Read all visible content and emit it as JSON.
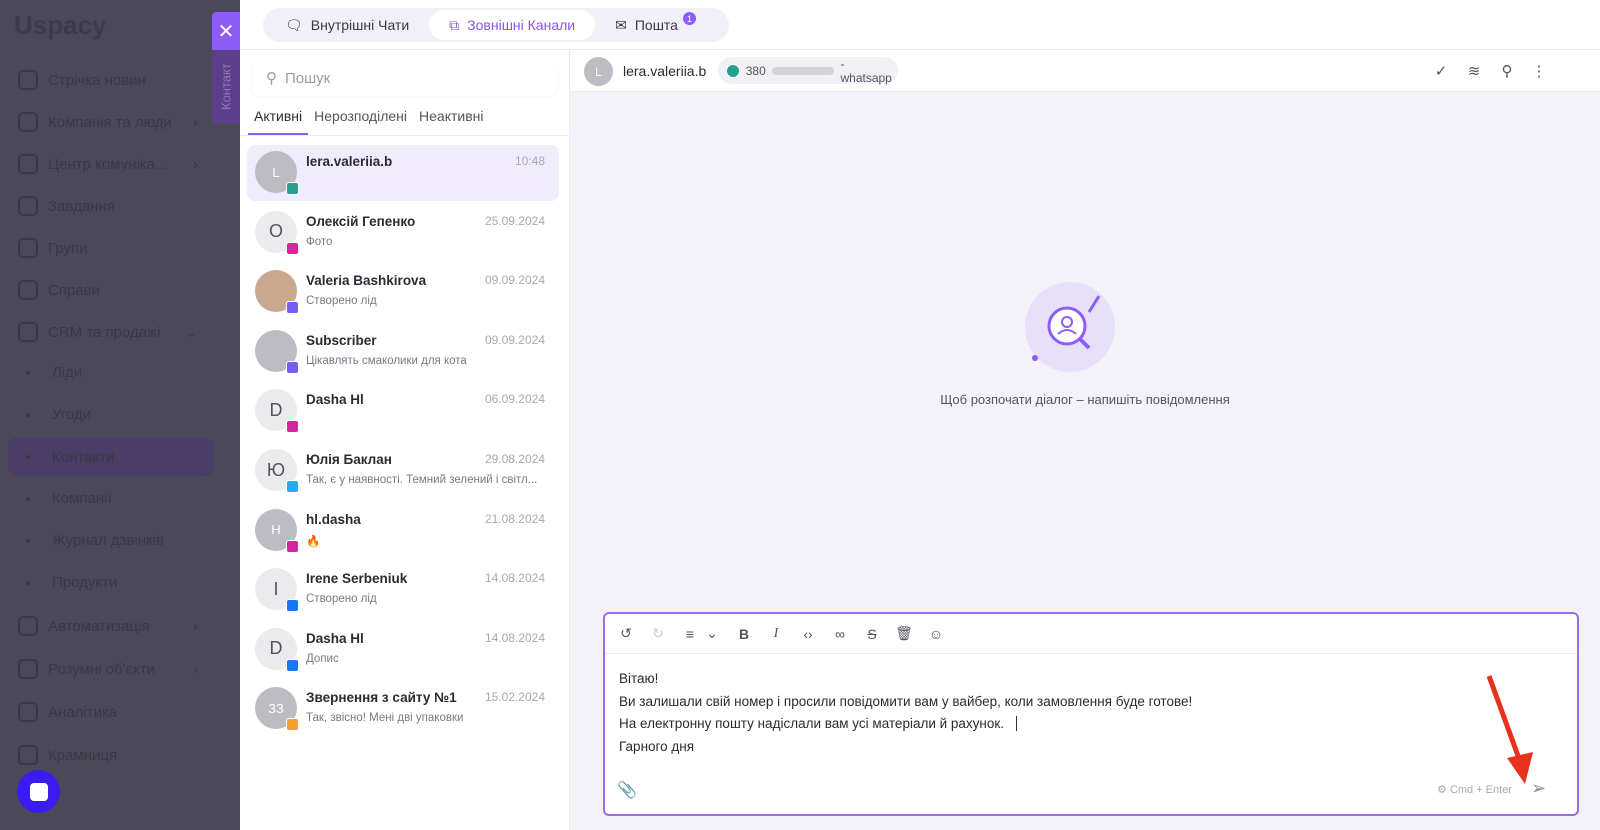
{
  "app": {
    "logo": "Uspacy",
    "nav": [
      {
        "label": "Стрічка новин",
        "chev": ""
      },
      {
        "label": "Компанія та люди",
        "chev": "›"
      },
      {
        "label": "Центр комуніка...",
        "chev": "›"
      },
      {
        "label": "Завдання",
        "chev": ""
      },
      {
        "label": "Групи",
        "chev": ""
      },
      {
        "label": "Справи",
        "chev": ""
      },
      {
        "label": "CRM та продажі",
        "chev": "⌄"
      }
    ],
    "sub": [
      "Ліди",
      "Угоди",
      "Контакти",
      "Компанії",
      "Журнал дзвінків",
      "Продукти"
    ],
    "nav2": [
      {
        "label": "Автоматизація",
        "chev": "›"
      },
      {
        "label": "Розумні об'єкти",
        "chev": "›"
      },
      {
        "label": "Аналітика",
        "chev": ""
      },
      {
        "label": "Крамниця",
        "chev": ""
      }
    ]
  },
  "drawer": {
    "close": "✕",
    "tab_label": "Контакт"
  },
  "tabs": [
    {
      "label": "Внутрішні Чати"
    },
    {
      "label": "Зовнішні Канали"
    },
    {
      "label": "Пошта",
      "badge": "1"
    }
  ],
  "search": {
    "placeholder": "Пошук"
  },
  "filters": [
    "Активні",
    "Нерозподілені",
    "Неактивні"
  ],
  "chats": [
    {
      "initial": "L",
      "name": "lera.valeriia.b",
      "time": "10:48",
      "preview": "",
      "channel": "whatsapp"
    },
    {
      "initial": "О",
      "name": "Олексій Гепенко",
      "time": "25.09.2024",
      "preview": "Фото",
      "channel": "instagram"
    },
    {
      "initial": "",
      "name": "Valeria Bashkirova",
      "time": "09.09.2024",
      "preview": "Створено лід",
      "channel": "viber"
    },
    {
      "initial": "",
      "name": "Subscriber",
      "time": "09.09.2024",
      "preview": "Цікавлять смаколики для кота",
      "channel": "viber"
    },
    {
      "initial": "D",
      "name": "Dasha Hl",
      "time": "06.09.2024",
      "preview": "",
      "channel": "instagram"
    },
    {
      "initial": "Ю",
      "name": "Юлія Баклан",
      "time": "29.08.2024",
      "preview": "Так, є у наявності. Темний зелений і світл...",
      "channel": "telegram"
    },
    {
      "initial": "H",
      "name": "hl.dasha",
      "time": "21.08.2024",
      "preview": "🔥",
      "channel": "instagram"
    },
    {
      "initial": "I",
      "name": "Irene Serbeniuk",
      "time": "14.08.2024",
      "preview": "Створено лід",
      "channel": "facebook"
    },
    {
      "initial": "D",
      "name": "Dasha Hl",
      "time": "14.08.2024",
      "preview": "Допис",
      "channel": "facebook"
    },
    {
      "initial": "ЗЗ",
      "name": "Звернення з сайту №1",
      "time": "15.02.2024",
      "preview": "Так, звісно! Мені дві упаковки",
      "channel": "widget"
    }
  ],
  "header": {
    "initial": "L",
    "name": "lera.valeriia.b",
    "phone_prefix": "380",
    "channel_suffix": "- whatsapp"
  },
  "empty_text": "Щоб розпочати діалог – напишіть повідомлення",
  "editor": {
    "lines": [
      "Вітаю!",
      "Ви залишали свій номер і просили повідомити вам у вайбер, коли замовлення буде готове!",
      "На електронну пошту надіслали вам усі матеріали й рахунок.",
      "Гарного дня"
    ],
    "hint": "Cmd + Enter"
  },
  "colors": {
    "accent": "#8e5cf7",
    "whatsapp": "#25a18e",
    "instagram": "#d6249f",
    "viber": "#7360f2",
    "telegram": "#2aabee",
    "facebook": "#1877f2",
    "widget": "#f0a030"
  }
}
